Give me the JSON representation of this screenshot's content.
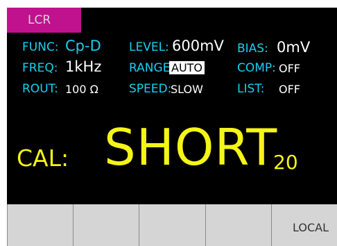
{
  "tab": {
    "label": "LCR"
  },
  "params": {
    "func": {
      "label": "FUNC:",
      "value": "Cp-D"
    },
    "freq": {
      "label": "FREQ:",
      "value": "1kHz"
    },
    "rout": {
      "label": "ROUT:",
      "value": "100 Ω"
    },
    "level": {
      "label": "LEVEL:",
      "value": "600mV"
    },
    "range": {
      "label": "RANGE:",
      "value": "AUTO"
    },
    "speed": {
      "label": "SPEED:",
      "value": "SLOW"
    },
    "bias": {
      "label": "BIAS:",
      "value": "0mV"
    },
    "comp": {
      "label": "COMP:",
      "value": "OFF"
    },
    "list": {
      "label": "LIST:",
      "value": "OFF"
    }
  },
  "calibration": {
    "label": "CAL:",
    "value": "SHORT",
    "count": "20"
  },
  "softkeys": [
    "",
    "",
    "",
    "",
    "LOCAL"
  ],
  "colors": {
    "label": "#19d0ef",
    "value": "#ffffff",
    "accent": "#f5f517",
    "tab": "#c0128e"
  }
}
